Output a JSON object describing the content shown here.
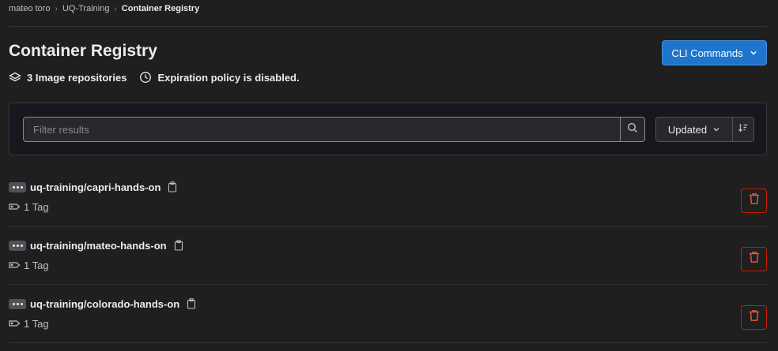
{
  "breadcrumb": [
    "mateo toro",
    "UQ-Training",
    "Container Registry"
  ],
  "page": {
    "title": "Container Registry",
    "repo_count": "3 Image repositories",
    "expiration": "Expiration policy is disabled."
  },
  "cli_button": "CLI Commands",
  "filter": {
    "placeholder": "Filter results",
    "sort_label": "Updated"
  },
  "repositories": [
    {
      "name": "uq-training/capri-hands-on",
      "tags": "1 Tag"
    },
    {
      "name": "uq-training/mateo-hands-on",
      "tags": "1 Tag"
    },
    {
      "name": "uq-training/colorado-hands-on",
      "tags": "1 Tag"
    }
  ],
  "colors": {
    "background": "#1f1f1f",
    "primary": "#1f75cb",
    "danger": "#c91c00"
  }
}
